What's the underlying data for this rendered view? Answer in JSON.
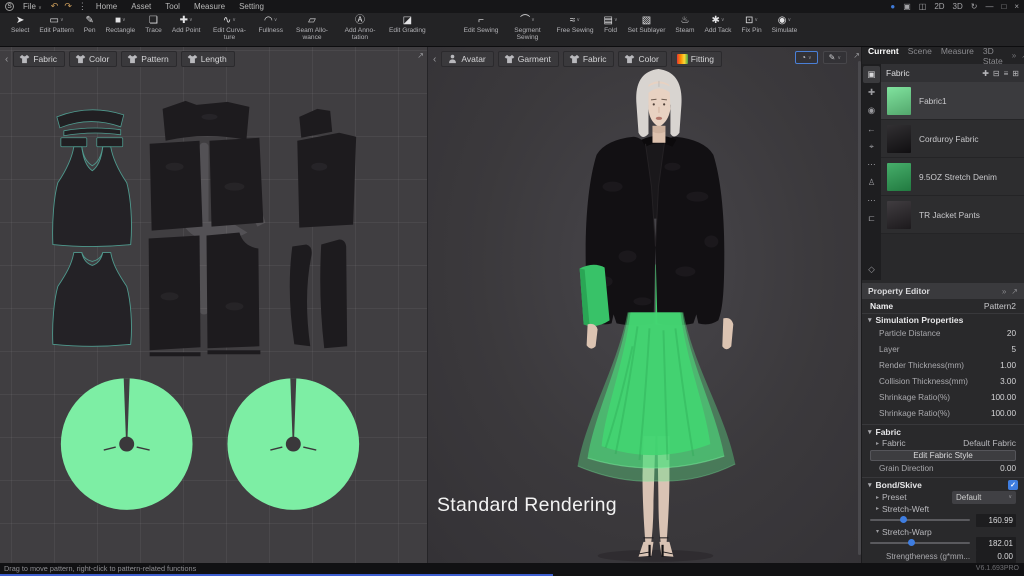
{
  "colors": {
    "accent_blue": "#3e7de0",
    "progress_blue": "#3d5ecf",
    "pattern_green": "#7deea4",
    "skirt_green": "#4cd877"
  },
  "app": {
    "logo_letter": "S",
    "file_menu": "File",
    "file_caret": "∨",
    "history_icons": [
      {
        "name": "undo-icon",
        "glyph": "↶",
        "color": "#c89a5a"
      },
      {
        "name": "redo-icon",
        "glyph": "↷",
        "color": "#c89a5a"
      },
      {
        "name": "more-icon",
        "glyph": "⋮",
        "color": "#9a9a9e"
      }
    ],
    "menus": [
      "Home",
      "Asset",
      "Tool",
      "Measure",
      "Setting"
    ],
    "titlebar_icons": [
      {
        "name": "account-icon",
        "glyph": "●",
        "color": "#3f7bd9"
      },
      {
        "name": "panel-layout-icon",
        "glyph": "▣"
      },
      {
        "name": "split-view-icon",
        "glyph": "◫"
      },
      {
        "name": "view-2d-button",
        "glyph": "2D"
      },
      {
        "name": "view-3d-button",
        "glyph": "3D"
      },
      {
        "name": "sync-icon",
        "glyph": "↻"
      },
      {
        "name": "minimize-button",
        "glyph": "—"
      },
      {
        "name": "maximize-button",
        "glyph": "□"
      },
      {
        "name": "close-button",
        "glyph": "×"
      }
    ]
  },
  "toolbar": {
    "group1": [
      {
        "label": "Select",
        "glyph": "➤",
        "dropdown": false
      },
      {
        "label": "Edit Pattern",
        "glyph": "▭",
        "dropdown": true
      },
      {
        "label": "Pen",
        "glyph": "✎",
        "dropdown": false
      },
      {
        "label": "Rectangle",
        "glyph": "■",
        "dropdown": true
      },
      {
        "label": "Trace",
        "glyph": "❏",
        "dropdown": false
      },
      {
        "label": "Add Point",
        "glyph": "✚",
        "dropdown": true
      },
      {
        "label": "Edit Curva-ture",
        "glyph": "∿",
        "dropdown": true
      },
      {
        "label": "Fullness",
        "glyph": "◠",
        "dropdown": true
      },
      {
        "label": "Seam Allo-wance",
        "glyph": "▱",
        "dropdown": false
      },
      {
        "label": "Add Anno-tation",
        "glyph": "Ⓐ",
        "dropdown": false
      },
      {
        "label": "Edit Grading",
        "glyph": "◪",
        "dropdown": false
      }
    ],
    "group2": [
      {
        "label": "Edit Sewing",
        "glyph": "⌐",
        "dropdown": false
      },
      {
        "label": "Segment Sewing",
        "glyph": "⌒",
        "dropdown": true
      },
      {
        "label": "Free Sewing",
        "glyph": "≈",
        "dropdown": true
      },
      {
        "label": "Fold",
        "glyph": "▤",
        "dropdown": true
      },
      {
        "label": "Set Sublayer",
        "glyph": "▧",
        "dropdown": false
      },
      {
        "label": "Steam",
        "glyph": "♨",
        "dropdown": false
      },
      {
        "label": "Add Tack",
        "glyph": "✱",
        "dropdown": true
      },
      {
        "label": "Fix Pin",
        "glyph": "⊡",
        "dropdown": true
      },
      {
        "label": "Simulate",
        "glyph": "◉",
        "dropdown": true
      }
    ]
  },
  "left_panel": {
    "collapse_chevron": "‹",
    "expand_glyph": "↗",
    "tabs": [
      {
        "label": "Fabric"
      },
      {
        "label": "Color"
      },
      {
        "label": "Pattern"
      },
      {
        "label": "Length"
      }
    ]
  },
  "center_panel": {
    "collapse_chevron": "‹",
    "expand_glyph": "↗",
    "tabs": [
      {
        "label": "Avatar",
        "person": true
      },
      {
        "label": "Garment"
      },
      {
        "label": "Fabric"
      },
      {
        "label": "Color"
      },
      {
        "label": "Fitting",
        "rainbow": true
      }
    ],
    "view_buttons": [
      {
        "name": "render-style-button",
        "glyph": "◔",
        "active": true
      },
      {
        "name": "brush-style-button",
        "glyph": "✎",
        "active": false
      }
    ],
    "overlay_label": "Standard Rendering"
  },
  "right_panel": {
    "tabs": [
      {
        "label": "Current",
        "active": true
      },
      {
        "label": "Scene",
        "active": false
      },
      {
        "label": "Measure",
        "active": false
      },
      {
        "label": "3D State",
        "active": false
      }
    ],
    "more_glyph": "»",
    "expand_glyph": "↗",
    "tool_strip": [
      {
        "name": "pattern-list-icon",
        "glyph": "▣",
        "active": true
      },
      {
        "name": "add-fabric-icon",
        "glyph": "✚",
        "active": false
      },
      {
        "name": "physical-property-icon",
        "glyph": "◉",
        "active": false
      },
      {
        "name": "arrow-left-icon",
        "glyph": "←",
        "active": false
      },
      {
        "name": "pin-icon",
        "glyph": "⌖",
        "active": false
      },
      {
        "name": "seam-line-icon",
        "glyph": "⋯",
        "active": false
      },
      {
        "name": "avatar-icon",
        "glyph": "♙",
        "active": false
      },
      {
        "name": "stitch-line-icon",
        "glyph": "⋯",
        "active": false
      },
      {
        "name": "bracket-icon",
        "glyph": "⊏",
        "active": false
      }
    ],
    "tool_strip_bottom": {
      "name": "cube-icon",
      "glyph": "◇"
    },
    "fabric_list": {
      "title": "Fabric",
      "header_icons": [
        {
          "name": "add-icon",
          "glyph": "✚"
        },
        {
          "name": "delete-icon",
          "glyph": "⊟"
        },
        {
          "name": "list-view-icon",
          "glyph": "≡"
        },
        {
          "name": "thumbnail-view-icon",
          "glyph": "⊞"
        }
      ],
      "items": [
        {
          "name": "Fabric1",
          "swatch": "#6fdf91",
          "selected": true
        },
        {
          "name": "Corduroy Fabric",
          "swatch": "#151316",
          "selected": false
        },
        {
          "name": "9.5OZ Stretch Denim",
          "swatch": "#2da356",
          "selected": false
        },
        {
          "name": "TR Jacket Pants",
          "swatch": "#262226",
          "selected": false
        }
      ]
    },
    "property_editor": {
      "title": "Property Editor",
      "name_label": "Name",
      "name_value": "Pattern2",
      "simulation": {
        "title": "Simulation Properties",
        "rows": [
          {
            "label": "Particle Distance",
            "value": "20"
          },
          {
            "label": "Layer",
            "value": "5"
          },
          {
            "label": "Render Thickness(mm)",
            "value": "1.00"
          },
          {
            "label": "Collision Thickness(mm)",
            "value": "3.00"
          },
          {
            "label": "Shrinkage Ratio(%)",
            "value": "100.00"
          },
          {
            "label": "Shrinkage Ratio(%)",
            "value": "100.00"
          }
        ]
      },
      "fabric": {
        "title": "Fabric",
        "row_label": "Fabric",
        "row_value": "Default Fabric",
        "button_label": "Edit  Fabric Style",
        "grain_label": "Grain Direction",
        "grain_value": "0.00"
      },
      "bond": {
        "title": "Bond/Skive",
        "checked": true,
        "check_glyph": "✓",
        "preset_label": "Preset",
        "preset_value": "Default",
        "weft_label": "Stretch-Weft",
        "weft_value": "160.99",
        "weft_pct": "33%",
        "warp_label": "Stretch-Warp",
        "warp_value": "182.01",
        "warp_pct": "41%",
        "strength_label": "Strengtheness  (g*mm...",
        "strength_value": "0.00"
      }
    }
  },
  "status_bar": {
    "hint": "Drag to move pattern, right-click to pattern-related functions",
    "version": "V6.1.693PRO"
  }
}
